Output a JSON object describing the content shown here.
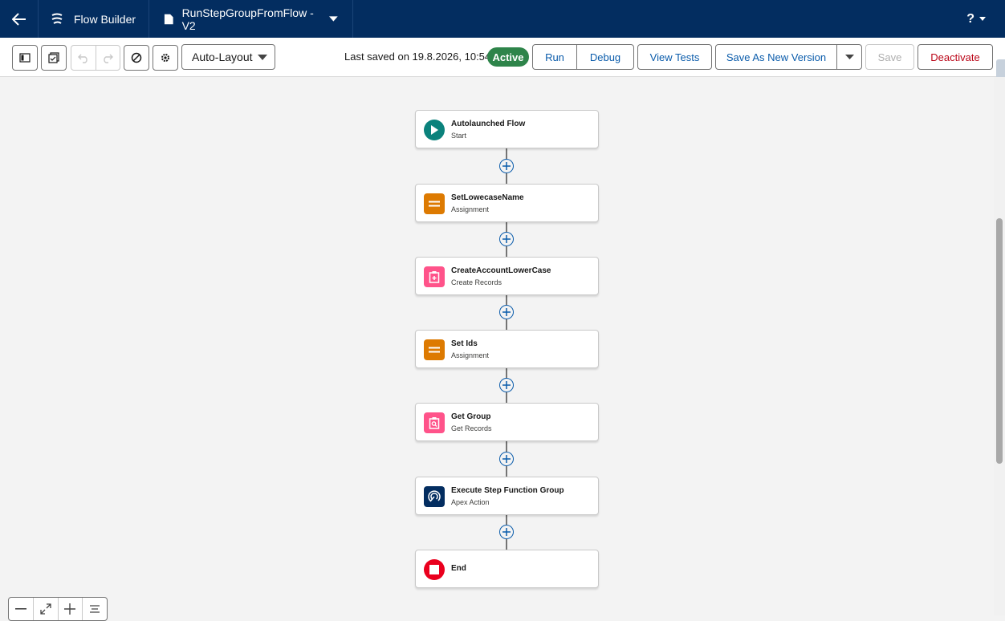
{
  "header": {
    "app_name": "Flow Builder",
    "file_name": "RunStepGroupFromFlow - V2",
    "help": "?"
  },
  "toolbar": {
    "layout_mode": "Auto-Layout",
    "last_saved": "Last saved on 19.8.2026, 10:54",
    "status": "Active",
    "run_label": "Run",
    "debug_label": "Debug",
    "view_tests_label": "View Tests",
    "save_as_new_label": "Save As New Version",
    "save_label": "Save",
    "deactivate_label": "Deactivate"
  },
  "flow": {
    "nodes": [
      {
        "title": "Autolaunched Flow",
        "subtitle": "Start",
        "icon": "play-icon",
        "color": "#0b827c"
      },
      {
        "title": "SetLowecaseName",
        "subtitle": "Assignment",
        "icon": "assignment-icon",
        "color": "#dd7a01"
      },
      {
        "title": "CreateAccountLowerCase",
        "subtitle": "Create Records",
        "icon": "create-records-icon",
        "color": "#ff538a"
      },
      {
        "title": "Set Ids",
        "subtitle": "Assignment",
        "icon": "assignment-icon",
        "color": "#dd7a01"
      },
      {
        "title": "Get Group",
        "subtitle": "Get Records",
        "icon": "get-records-icon",
        "color": "#ff538a"
      },
      {
        "title": "Execute Step Function Group",
        "subtitle": "Apex Action",
        "icon": "apex-icon",
        "color": "#032d60"
      },
      {
        "title": "End",
        "subtitle": "",
        "icon": "stop-icon",
        "color": "#ea001e"
      }
    ]
  },
  "colors": {
    "header_bg": "#032d60",
    "brand_blue": "#0b5cab",
    "active_green": "#2e844a",
    "danger_red": "#ba0517"
  }
}
